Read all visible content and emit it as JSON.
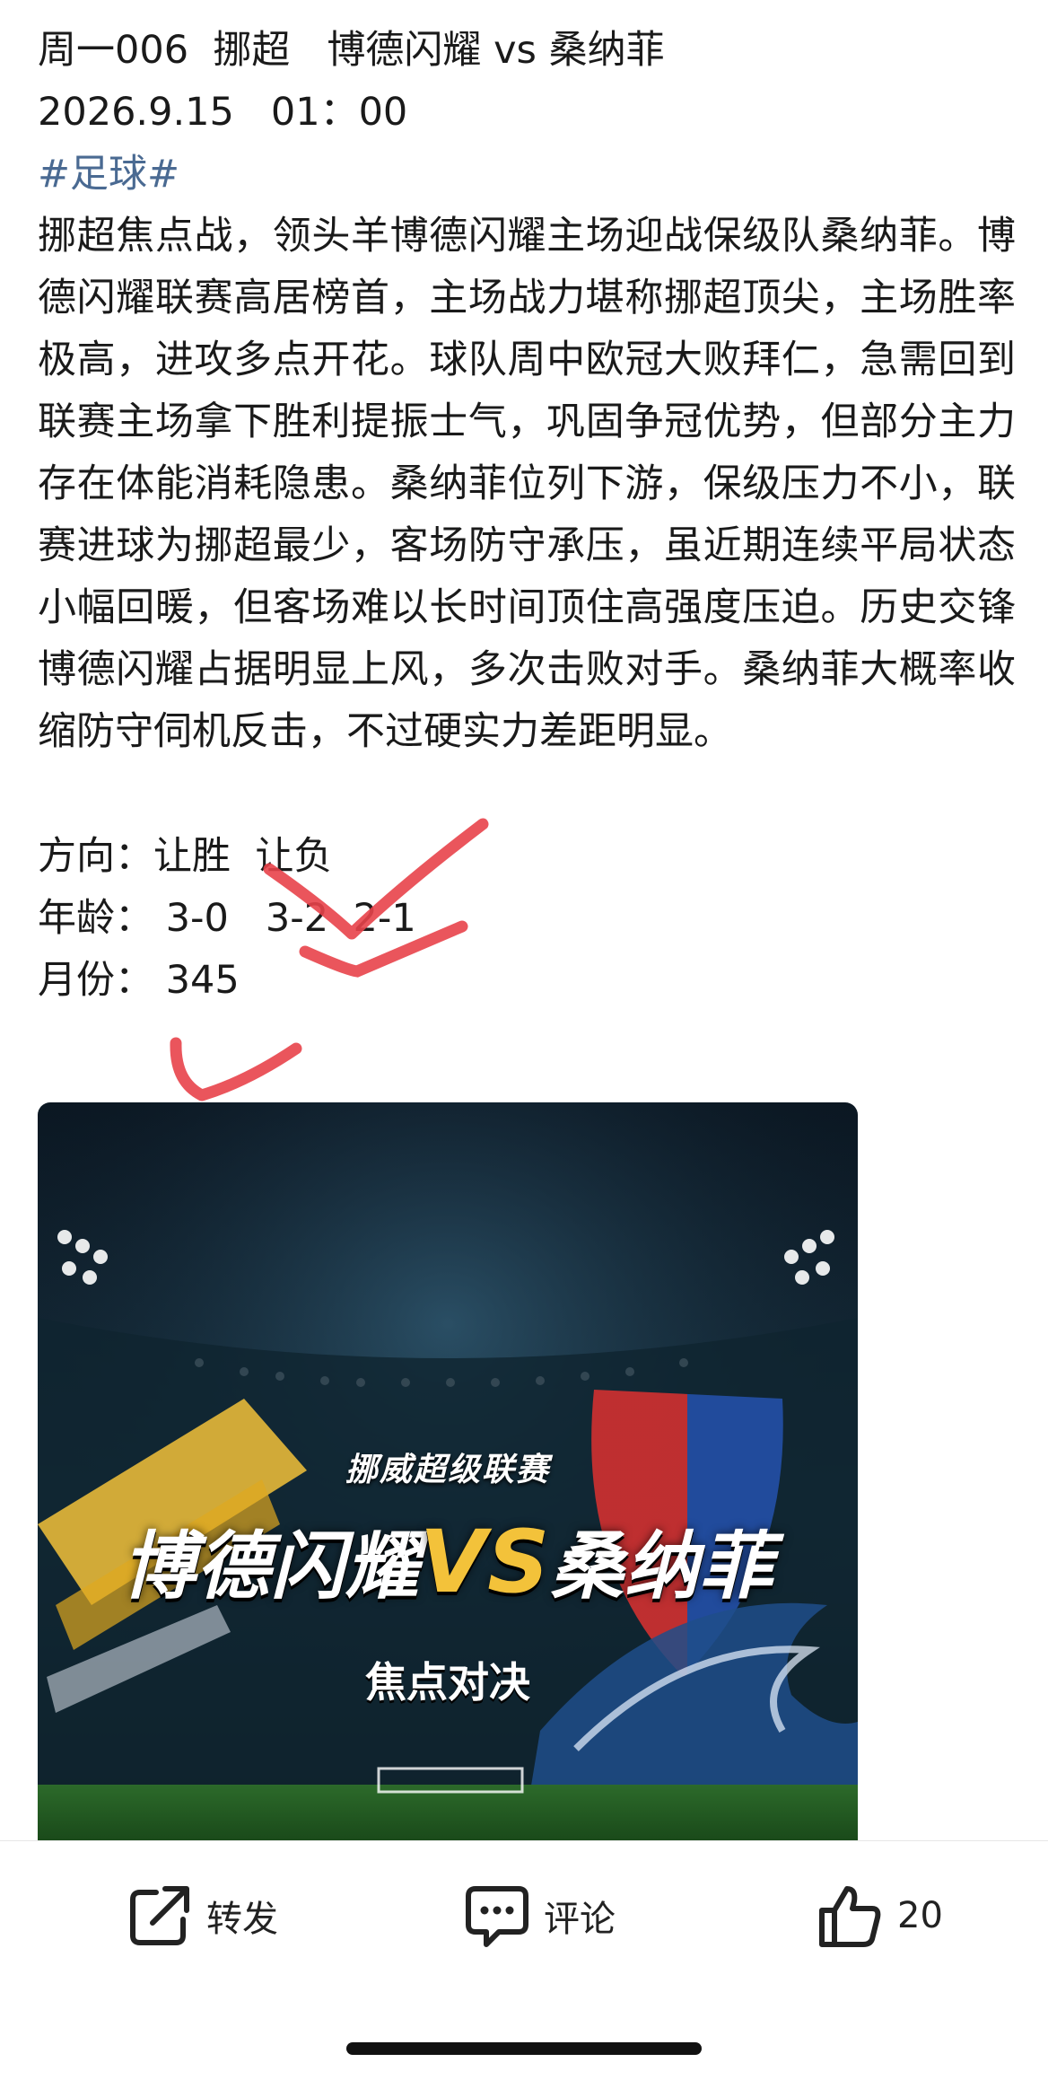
{
  "post": {
    "header_line": "周一006  挪超   博德闪耀 vs 桑纳菲",
    "datetime": "2026.9.15   01：00",
    "hashtag": "#足球#",
    "body": "挪超焦点战，领头羊博德闪耀主场迎战保级队桑纳菲。博德闪耀联赛高居榜首，主场战力堪称挪超顶尖，主场胜率极高，进攻多点开花。球队周中欧冠大败拜仁，急需回到联赛主场拿下胜利提振士气，巩固争冠优势，但部分主力存在体能消耗隐患。桑纳菲位列下游，保级压力不小，联赛进球为挪超最少，客场防守承压，虽近期连续平局状态小幅回暖，但客场难以长时间顶住高强度压迫。历史交锋博德闪耀占据明显上风，多次击败对手。桑纳菲大概率收缩防守伺机反击，不过硬实力差距明显。",
    "picks": {
      "direction_label": "方向：",
      "direction_value": "让胜  让负",
      "age_label": "年龄：",
      "age_value": " 3-0   3-2  2-1",
      "month_label": "月份：",
      "month_value": " 345"
    }
  },
  "banner": {
    "league": "挪威超级联赛",
    "home": "博德闪耀",
    "vs": "VS",
    "away": "桑纳菲",
    "subtitle": "焦点对决"
  },
  "actions": {
    "share_label": "转发",
    "comment_label": "评论",
    "like_count": "20"
  },
  "colors": {
    "hashtag": "#4a6a92",
    "check_mark": "#e8434a",
    "vs_gold": "#f3c23a"
  },
  "icons": [
    "share-icon",
    "comment-icon",
    "like-icon",
    "check-mark"
  ]
}
